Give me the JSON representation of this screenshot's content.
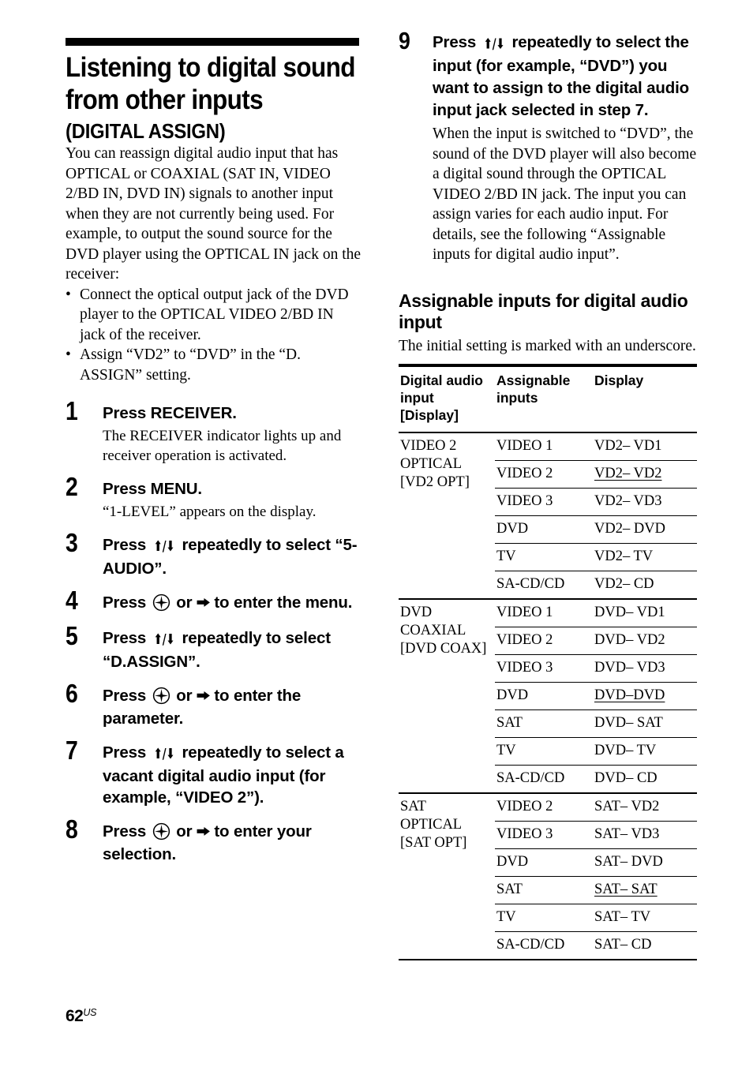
{
  "page": {
    "number": "62",
    "region_suffix": "US"
  },
  "left_column": {
    "title": "Listening to digital sound from other inputs",
    "subtitle": "(DIGITAL ASSIGN)",
    "intro_paragraph": "You can reassign digital audio input that has OPTICAL or COAXIAL (SAT IN, VIDEO 2/BD IN, DVD IN) signals to another input when they are not currently being used. For example, to output the sound source for the DVD player using the OPTICAL IN jack on the receiver:",
    "bullet_marker": "•",
    "bullets": [
      "Connect the optical output jack of the DVD player to the OPTICAL VIDEO 2/BD IN jack of the receiver.",
      "Assign “VD2” to “DVD” in the “D. ASSIGN” setting."
    ],
    "steps": [
      {
        "number": "1",
        "heading_parts": [
          "Press RECEIVER."
        ],
        "body": "The RECEIVER indicator lights up and receiver operation is activated."
      },
      {
        "number": "2",
        "heading_parts": [
          "Press MENU."
        ],
        "body": "“1-LEVEL” appears on the display."
      },
      {
        "number": "3",
        "heading_pre": "Press ",
        "heading_arrows": "⬆/⬇",
        "heading_post": " repeatedly to select “5-AUDIO”.",
        "body": ""
      },
      {
        "number": "4",
        "heading_pre": "Press ",
        "heading_mid": " or ",
        "heading_arrow_right": "⮕",
        "heading_post": " to enter the menu.",
        "body": ""
      },
      {
        "number": "5",
        "heading_pre": "Press ",
        "heading_arrows": "⬆/⬇",
        "heading_post": " repeatedly to select “D.ASSIGN”.",
        "body": ""
      },
      {
        "number": "6",
        "heading_pre": "Press ",
        "heading_mid": " or ",
        "heading_arrow_right": "⮕",
        "heading_post": " to enter the parameter.",
        "body": ""
      },
      {
        "number": "7",
        "heading_pre": "Press ",
        "heading_arrows": "⬆/⬇",
        "heading_post": " repeatedly to select a vacant digital audio input (for example, “VIDEO 2”).",
        "body": ""
      },
      {
        "number": "8",
        "heading_pre": "Press ",
        "heading_mid": " or ",
        "heading_arrow_right": "⮕",
        "heading_post": " to enter your selection.",
        "body": ""
      }
    ]
  },
  "right_column": {
    "step9": {
      "number": "9",
      "heading_pre": "Press ",
      "heading_arrows": "⬆/⬇",
      "heading_post": " repeatedly to select the input (for example, “DVD”) you want to assign to the digital audio input jack selected in step 7.",
      "body": "When the input is switched to “DVD”, the sound of the DVD player will also become a digital sound through the OPTICAL VIDEO 2/BD IN jack. The input you can assign varies for each audio input. For details, see the following “Assignable inputs for digital audio input”."
    },
    "section_heading": "Assignable inputs for digital audio input",
    "section_note": "The initial setting is marked with an underscore.",
    "table": {
      "headers": [
        "Digital audio input [Display]",
        "Assignable inputs",
        "Display"
      ],
      "groups": [
        {
          "label": "VIDEO 2 OPTICAL [VD2  OPT]",
          "rows": [
            {
              "input": "VIDEO 1",
              "display": "VD2– VD1",
              "initial": false
            },
            {
              "input": "VIDEO 2",
              "display": "VD2– VD2",
              "initial": true
            },
            {
              "input": "VIDEO 3",
              "display": "VD2– VD3",
              "initial": false
            },
            {
              "input": "DVD",
              "display": "VD2– DVD",
              "initial": false
            },
            {
              "input": "TV",
              "display": "VD2– TV",
              "initial": false
            },
            {
              "input": "SA-CD/CD",
              "display": "VD2– CD",
              "initial": false
            }
          ]
        },
        {
          "label": "DVD COAXIAL [DVD COAX]",
          "rows": [
            {
              "input": "VIDEO 1",
              "display": "DVD– VD1",
              "initial": false
            },
            {
              "input": "VIDEO 2",
              "display": "DVD– VD2",
              "initial": false
            },
            {
              "input": "VIDEO 3",
              "display": "DVD– VD3",
              "initial": false
            },
            {
              "input": "DVD",
              "display": "DVD–DVD",
              "initial": true
            },
            {
              "input": "SAT",
              "display": "DVD– SAT",
              "initial": false
            },
            {
              "input": "TV",
              "display": "DVD– TV",
              "initial": false
            },
            {
              "input": "SA-CD/CD",
              "display": "DVD– CD",
              "initial": false
            }
          ]
        },
        {
          "label": "SAT OPTICAL [SAT  OPT]",
          "rows": [
            {
              "input": "VIDEO 2",
              "display": "SAT– VD2",
              "initial": false
            },
            {
              "input": "VIDEO 3",
              "display": "SAT– VD3",
              "initial": false
            },
            {
              "input": "DVD",
              "display": "SAT– DVD",
              "initial": false
            },
            {
              "input": "SAT",
              "display": "SAT– SAT",
              "initial": true
            },
            {
              "input": "TV",
              "display": "SAT– TV",
              "initial": false
            },
            {
              "input": "SA-CD/CD",
              "display": "SAT– CD",
              "initial": false
            }
          ]
        }
      ]
    }
  },
  "icons": {
    "enter_button": "enter-button-icon",
    "arrow_up_down": "arrow-up-down-icon",
    "arrow_right": "arrow-right-icon"
  }
}
